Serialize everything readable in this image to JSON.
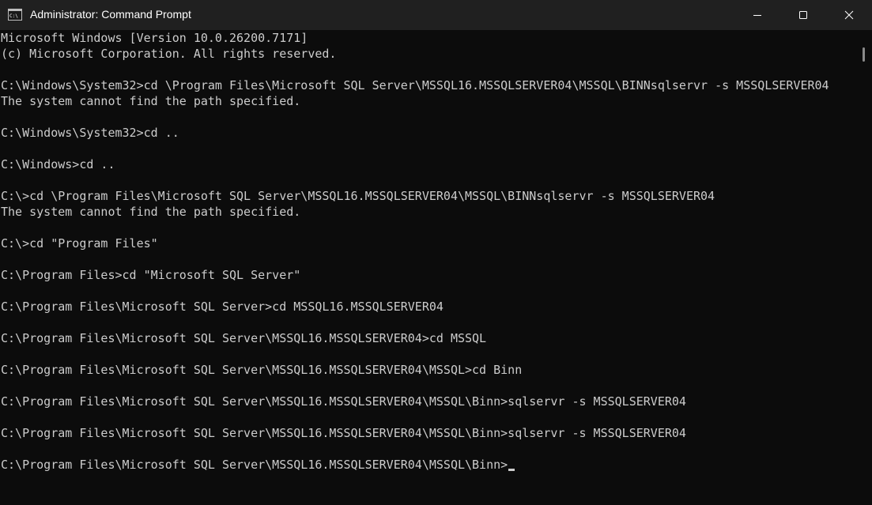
{
  "window": {
    "title": "Administrator: Command Prompt",
    "icon": "cmd-app-icon",
    "controls": [
      "minimize-icon",
      "maximize-icon",
      "close-icon"
    ]
  },
  "colors": {
    "titlebar_bg": "#202020",
    "terminal_bg": "#0c0c0c",
    "terminal_fg": "#cccccc"
  },
  "terminal": {
    "lines": [
      "Microsoft Windows [Version 10.0.26200.7171]",
      "(c) Microsoft Corporation. All rights reserved.",
      "",
      "C:\\Windows\\System32>cd \\Program Files\\Microsoft SQL Server\\MSSQL16.MSSQLSERVER04\\MSSQL\\BINNsqlservr -s MSSQLSERVER04",
      "The system cannot find the path specified.",
      "",
      "C:\\Windows\\System32>cd ..",
      "",
      "C:\\Windows>cd ..",
      "",
      "C:\\>cd \\Program Files\\Microsoft SQL Server\\MSSQL16.MSSQLSERVER04\\MSSQL\\BINNsqlservr -s MSSQLSERVER04",
      "The system cannot find the path specified.",
      "",
      "C:\\>cd \"Program Files\"",
      "",
      "C:\\Program Files>cd \"Microsoft SQL Server\"",
      "",
      "C:\\Program Files\\Microsoft SQL Server>cd MSSQL16.MSSQLSERVER04",
      "",
      "C:\\Program Files\\Microsoft SQL Server\\MSSQL16.MSSQLSERVER04>cd MSSQL",
      "",
      "C:\\Program Files\\Microsoft SQL Server\\MSSQL16.MSSQLSERVER04\\MSSQL>cd Binn",
      "",
      "C:\\Program Files\\Microsoft SQL Server\\MSSQL16.MSSQLSERVER04\\MSSQL\\Binn>sqlservr -s MSSQLSERVER04",
      "",
      "C:\\Program Files\\Microsoft SQL Server\\MSSQL16.MSSQLSERVER04\\MSSQL\\Binn>sqlservr -s MSSQLSERVER04",
      "",
      "C:\\Program Files\\Microsoft SQL Server\\MSSQL16.MSSQLSERVER04\\MSSQL\\Binn>"
    ]
  }
}
